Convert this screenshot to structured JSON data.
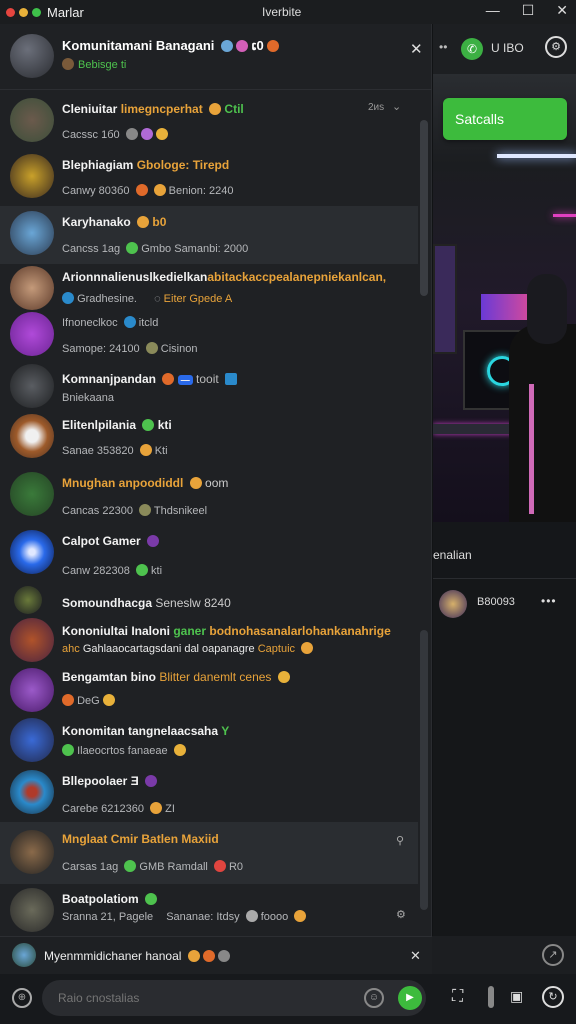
{
  "window": {
    "title": "Marlar",
    "center_title": "Iverbite",
    "controls": [
      "—",
      "☐",
      "✕"
    ]
  },
  "chat_header": {
    "title": "Komunitamani Banagani",
    "title_suffix": "ເ0",
    "subtitle": "Bebisge",
    "subtitle_tag": "ti",
    "close": "✕"
  },
  "right_header": {
    "count": "U IBO"
  },
  "right_panel": {
    "action_button": "Satcalls",
    "section_label": "enalian",
    "user_name": "B80093",
    "more": "•••"
  },
  "chats": [
    {
      "name": "Cleniuitar",
      "name_extra": "limegncperhat",
      "name_tag": "Ctil",
      "time": "2иs",
      "sub": "Cacssc 1б0",
      "highlight": "",
      "colors": [
        "#6b5a4c",
        "#3c4f3a"
      ]
    },
    {
      "name": "Blephiagiam",
      "name_extra": "Gbologe: Tirepd",
      "name_tag": "",
      "time": "",
      "sub": "Canwy 803б0",
      "sub2": "Benion: 2240",
      "colors": [
        "#c9a12a",
        "#3a2a1f"
      ]
    },
    {
      "name": "Karyhanako",
      "name_extra": "",
      "name_tag": "b0",
      "time": "",
      "sub": "Cancss 1ag",
      "sub2": "Gmbo Samanbi: 2000",
      "colors": [
        "#6aa6d6",
        "#2c3c52"
      ]
    },
    {
      "name": "Arionnnalienuslkedielkan",
      "name_extra": "abitackaccpealanepniekanlcan,",
      "name_tag": "",
      "time": "",
      "sub": "Gradhesine.",
      "sub2": "Eiter Gpede A",
      "colors": [
        "#c49a7a",
        "#5c3a2a"
      ]
    },
    {
      "name": "",
      "name_extra": "",
      "name_tag": "",
      "time": "",
      "sub": "Ifnoneclkoc",
      "sub2": "itcld",
      "sub3": "Samope: 24100",
      "sub4": "Cisinon",
      "colors": [
        "#9b38c9",
        "#6c2494"
      ]
    },
    {
      "name": "Komnanjpandan",
      "name_extra": "",
      "name_tag": "",
      "time": "",
      "sub": "tooit",
      "sub2": "Bniekaana",
      "colors": [
        "#3b3e42",
        "#1e2022"
      ]
    },
    {
      "name": "Elitenlpilania",
      "name_extra": "",
      "name_tag": "kti",
      "time": "",
      "sub": "Sanae 353820",
      "sub2": "Kti",
      "colors": [
        "#9d5a2a",
        "#4a3022"
      ]
    },
    {
      "name": "Mnughan",
      "name_extra": "anpoodiddl",
      "name_tag": "",
      "time": "",
      "sub": "Cancas 22300",
      "sub2": "Thdsnikeel",
      "colors": [
        "#3a7a3a",
        "#254425"
      ]
    },
    {
      "name": "Calpot Gamer",
      "name_extra": "",
      "name_tag": "",
      "time": "",
      "sub": "Canw 282308",
      "sub2": "kti",
      "colors": [
        "#2a6aea",
        "#0b1844"
      ]
    },
    {
      "name": "Somoundhacga",
      "name_extra": "Seneslw",
      "name_tag": "8240",
      "time": "",
      "sub": "",
      "colors": [
        "#2f3238",
        "#1c1e21"
      ]
    },
    {
      "name": "Kononiultai Inaloni",
      "name_extra": "ganer",
      "name_tag": "bodnohasanalarlohankanahrige",
      "time": "",
      "sub": "ahc",
      "sub2": "Gahlaaocartagsdani dal oapanagre",
      "sub3": "Captuic",
      "colors": [
        "#b0532a",
        "#4a2340"
      ]
    },
    {
      "name": "Bengamtan bino",
      "name_extra": "Blitter danemlt cenes",
      "name_tag": "",
      "time": "",
      "sub": "DeG",
      "colors": [
        "#7a3aa8",
        "#4a1a6a"
      ]
    },
    {
      "name": "Konomitan",
      "name_extra": "tangnelaacsaha",
      "name_tag": "Y",
      "time": "",
      "sub": "Ilaeocrtos fanaeae",
      "colors": [
        "#3a6ad6",
        "#21284a"
      ]
    },
    {
      "name": "Bllepoolaer",
      "name_extra": "Ǝ",
      "name_tag": "",
      "time": "",
      "sub": "Carebe 6212360",
      "sub2": "ZI",
      "colors": [
        "#2a8acb",
        "#b03a2a"
      ]
    },
    {
      "name": "Mnglaat",
      "name_extra": "Cmir Batlen Maxiid",
      "name_tag": "",
      "time": "",
      "sub": "Carsas 1ag",
      "sub2": "GMB Ramdall",
      "sub3": "R0",
      "colors": [
        "#4a3a2a",
        "#222"
      ]
    },
    {
      "name": "Boatpolatiom",
      "name_extra": "",
      "name_tag": "",
      "time": "",
      "sub": "Sranna 21, Pagele",
      "sub2": "Sananae: Itdsy",
      "sub3": "foooo",
      "colors": [
        "#6a6a5a",
        "#2a2a2a"
      ]
    }
  ],
  "notification": {
    "text": "Myenmmidichaner hanoal",
    "close": "✕"
  },
  "composer": {
    "placeholder": "Raio cnostalias"
  }
}
